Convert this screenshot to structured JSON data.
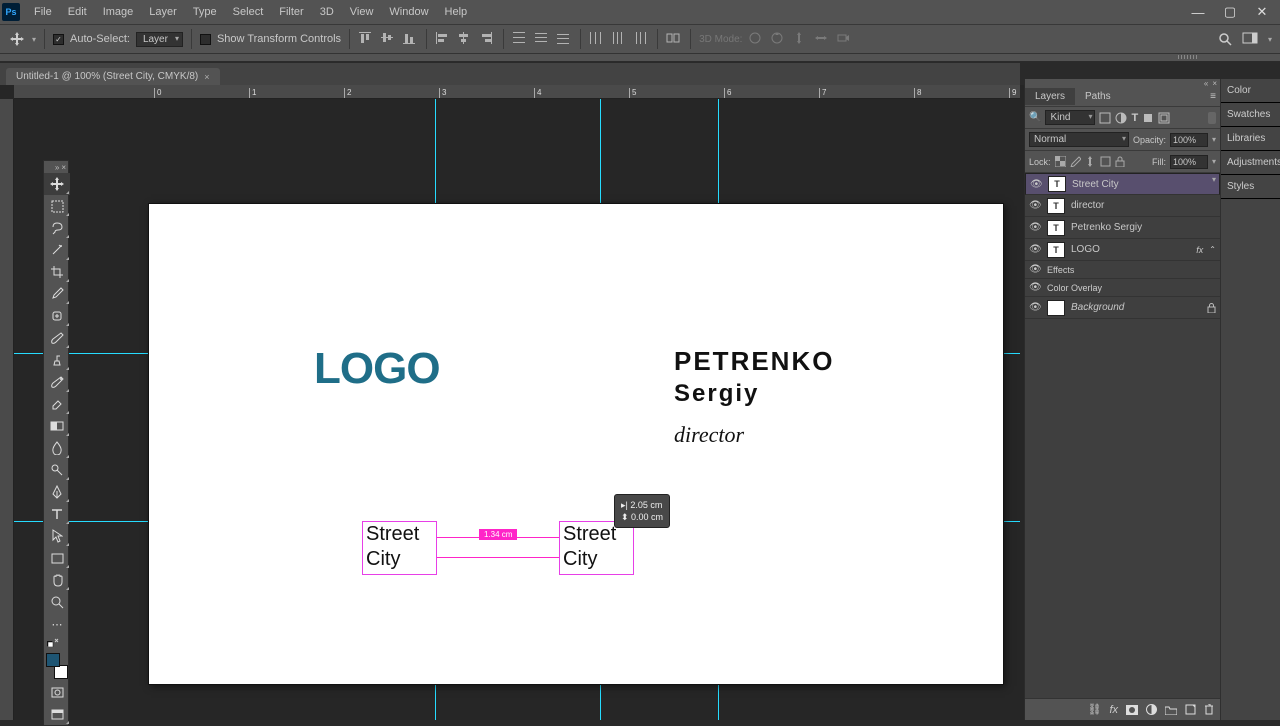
{
  "menu": {
    "items": [
      "File",
      "Edit",
      "Image",
      "Layer",
      "Type",
      "Select",
      "Filter",
      "3D",
      "View",
      "Window",
      "Help"
    ],
    "ps": "Ps"
  },
  "options": {
    "autoSelectLabel": "Auto-Select:",
    "autoSelectTarget": "Layer",
    "showTransformLabel": "Show Transform Controls",
    "modeLabel3d": "3D Mode:"
  },
  "docTab": {
    "title": "Untitled-1 @ 100% (Street City, CMYK/8)",
    "close": "×"
  },
  "ruler": {
    "ticks": [
      "0",
      "1",
      "2",
      "3",
      "4",
      "5",
      "6",
      "7",
      "8",
      "9"
    ]
  },
  "artwork": {
    "logo": "LOGO",
    "nameLine1": "PETRENKO",
    "nameLine2": "Sergiy",
    "role": "director",
    "block1": {
      "line1": "Street",
      "line2": "City"
    },
    "block2": {
      "line1": "Street",
      "line2": "City"
    },
    "gapLabel": "1.34 cm",
    "smartTip": {
      "dx": "▸| 2.05 cm",
      "dy": "⬍ 0.00 cm"
    }
  },
  "rightStrip": {
    "tabs": [
      "Color",
      "Swatches",
      "Libraries",
      "Adjustments",
      "Styles"
    ]
  },
  "layersPanel": {
    "tabs": {
      "layers": "Layers",
      "paths": "Paths"
    },
    "filter": {
      "label": "Kind"
    },
    "blend": {
      "mode": "Normal",
      "opacityLabel": "Opacity:",
      "opacity": "100%"
    },
    "lock": {
      "label": "Lock:",
      "fillLabel": "Fill:",
      "fill": "100%"
    },
    "layers": [
      {
        "name": "Street City",
        "type": "T",
        "selected": true
      },
      {
        "name": "director",
        "type": "T"
      },
      {
        "name": "Petrenko Sergiy",
        "type": "T"
      },
      {
        "name": "LOGO",
        "type": "T",
        "fx": true
      }
    ],
    "effects": {
      "label": "Effects",
      "item": "Color Overlay"
    },
    "background": {
      "name": "Background"
    }
  },
  "tools": [
    "move",
    "rect-marquee",
    "lasso",
    "magic-wand",
    "crop",
    "eyedropper",
    "healing",
    "brush",
    "clone-stamp",
    "history-brush",
    "eraser",
    "gradient",
    "blur",
    "dodge",
    "pen",
    "type",
    "path-select",
    "rectangle",
    "hand",
    "zoom",
    "more"
  ]
}
